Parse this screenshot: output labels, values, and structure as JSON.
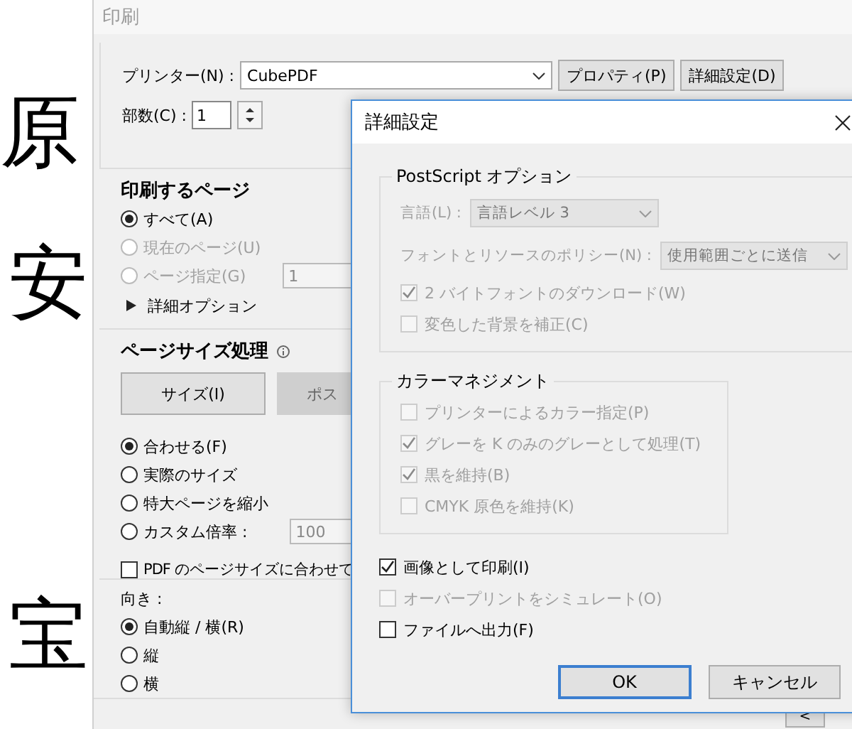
{
  "document": {
    "glyphs": [
      "原",
      "安",
      "宝"
    ]
  },
  "print_dialog": {
    "title": "印刷",
    "printer": {
      "label": "プリンター(N) :",
      "value": "CubePDF"
    },
    "buttons": [
      "プロパティ(P)",
      "詳細設定(D)"
    ],
    "copies": {
      "label": "部数(C) :",
      "value": "1"
    },
    "pages": {
      "heading": "印刷するページ",
      "options": [
        {
          "label": "すべて(A)",
          "selected": true,
          "disabled": false
        },
        {
          "label": "現在のページ(U)",
          "selected": false,
          "disabled": true
        },
        {
          "label": "ページ指定(G)",
          "selected": false,
          "disabled": true
        }
      ],
      "range_value": "1",
      "more_options": "詳細オプション"
    },
    "page_sizing": {
      "heading": "ページサイズ処理",
      "modes": [
        {
          "label": "サイズ(I)",
          "selected": true
        },
        {
          "label": "ポス",
          "selected": false
        }
      ],
      "options": [
        {
          "label": "合わせる(F)",
          "selected": true
        },
        {
          "label": "実際のサイズ",
          "selected": false
        },
        {
          "label": "特大ページを縮小",
          "selected": false
        },
        {
          "label": "カスタム倍率 :",
          "selected": false
        }
      ],
      "scale_value": "100",
      "fit_checkbox": {
        "label": "PDF のページサイズに合わせて",
        "checked": false
      }
    },
    "orientation": {
      "label": "向き :",
      "options": [
        {
          "label": "自動縦 / 横(R)",
          "selected": true
        },
        {
          "label": "縦",
          "selected": false
        },
        {
          "label": "横",
          "selected": false
        }
      ]
    },
    "nav_button": "<"
  },
  "advanced_dialog": {
    "title": "詳細設定",
    "postscript": {
      "heading": "PostScript オプション",
      "language": {
        "label": "言語(L) :",
        "value": "言語レベル 3",
        "disabled": true
      },
      "font_policy": {
        "label": "フォントとリソースのポリシー(N) :",
        "value": "使用範囲ごとに送信",
        "disabled": true
      },
      "checkboxes": [
        {
          "label": "2 バイトフォントのダウンロード(W)",
          "checked": true,
          "disabled": true
        },
        {
          "label": "変色した背景を補正(C)",
          "checked": false,
          "disabled": true
        }
      ]
    },
    "color_management": {
      "heading": "カラーマネジメント",
      "checkboxes": [
        {
          "label": "プリンターによるカラー指定(P)",
          "checked": false,
          "disabled": true
        },
        {
          "label": "グレーを K のみのグレーとして処理(T)",
          "checked": true,
          "disabled": true
        },
        {
          "label": "黒を維持(B)",
          "checked": true,
          "disabled": true
        },
        {
          "label": "CMYK 原色を維持(K)",
          "checked": false,
          "disabled": true
        }
      ]
    },
    "checkboxes": [
      {
        "label": "画像として印刷(I)",
        "checked": true,
        "disabled": false
      },
      {
        "label": "オーバープリントをシミュレート(O)",
        "checked": false,
        "disabled": true
      },
      {
        "label": "ファイルへ出力(F)",
        "checked": false,
        "disabled": false
      }
    ],
    "buttons": [
      {
        "label": "OK",
        "default": true
      },
      {
        "label": "キャンセル",
        "default": false
      }
    ]
  }
}
